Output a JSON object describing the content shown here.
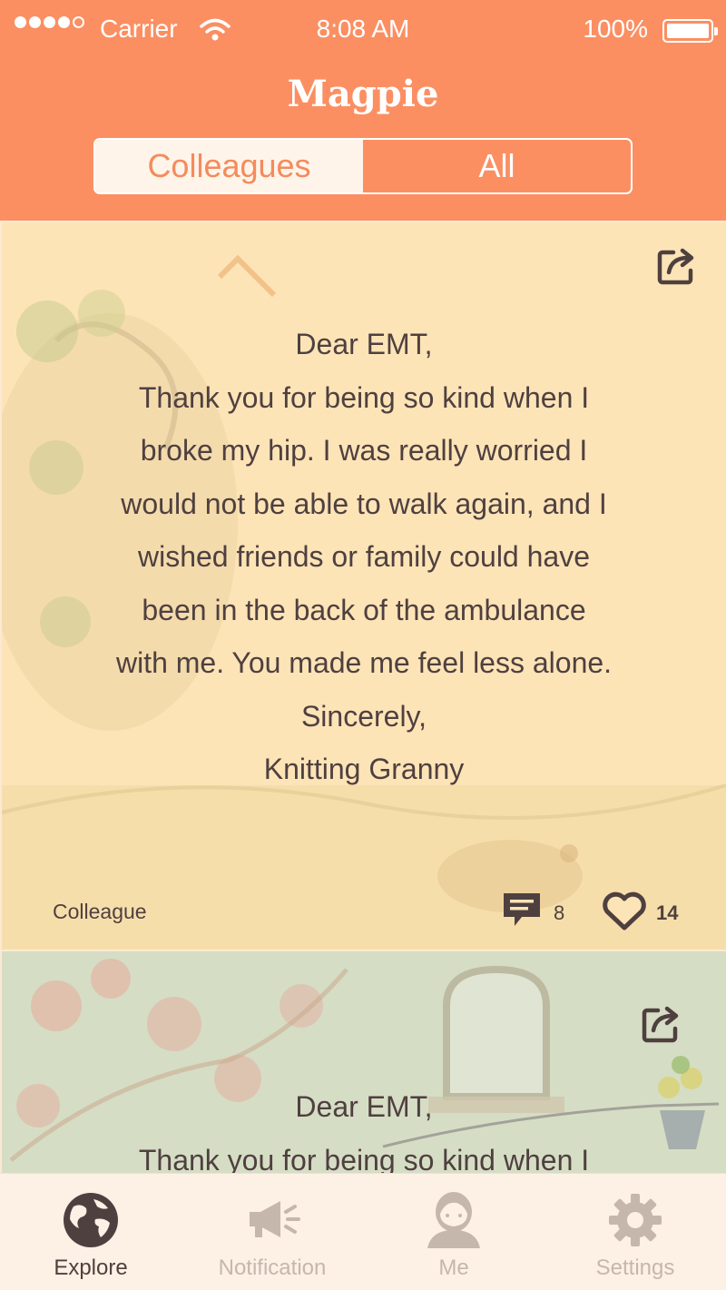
{
  "status_bar": {
    "carrier": "Carrier",
    "time": "8:08 AM",
    "battery": "100%",
    "icons": [
      "signal-dots-icon",
      "wifi-icon",
      "battery-icon"
    ]
  },
  "header": {
    "title": "Magpie",
    "segments": [
      {
        "label": "Colleagues",
        "selected": true
      },
      {
        "label": "All",
        "selected": false
      }
    ]
  },
  "colors": {
    "header_bg": "#fb8f62",
    "card1_bg": "#fde4b7",
    "card2_bg": "#d6ddc5",
    "text": "#4f4040",
    "tab_inactive": "#c6b7ad"
  },
  "cards": [
    {
      "greeting": "Dear EMT,",
      "lines": [
        "Thank you for being so kind when I",
        "broke my hip. I was really worried I",
        "would not be able to walk again, and I",
        "wished friends or family could have",
        "been in the back of the ambulance",
        "with me. You made me feel less alone."
      ],
      "closing": "Sincerely,",
      "signature": "Knitting Granny",
      "tag": "Colleague",
      "comments": "8",
      "likes": "14"
    },
    {
      "greeting": "Dear EMT,",
      "lines": [
        "Thank you for being so kind when I"
      ]
    }
  ],
  "tabs": [
    {
      "label": "Explore",
      "icon": "globe-icon",
      "active": true
    },
    {
      "label": "Notification",
      "icon": "megaphone-icon",
      "active": false
    },
    {
      "label": "Me",
      "icon": "person-icon",
      "active": false
    },
    {
      "label": "Settings",
      "icon": "gear-icon",
      "active": false
    }
  ]
}
